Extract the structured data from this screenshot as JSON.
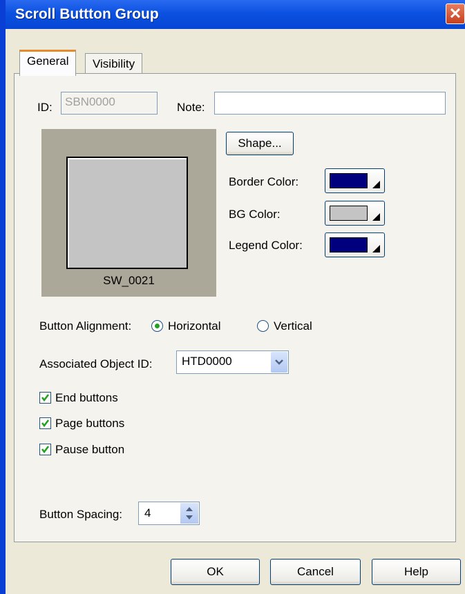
{
  "window": {
    "title": "Scroll Buttton Group",
    "close_label": "✕"
  },
  "tabs": [
    {
      "label": "General"
    },
    {
      "label": "Visibility"
    }
  ],
  "general": {
    "id_label": "ID:",
    "id_value": "SBN0000",
    "note_label": "Note:",
    "note_value": "",
    "shape_button": "Shape...",
    "preview_caption": "SW_0021",
    "border_color_label": "Border Color:",
    "border_color": "#00007f",
    "bg_color_label": "BG Color:",
    "bg_color": "#c4c4c4",
    "legend_color_label": "Legend Color:",
    "legend_color": "#00007f",
    "alignment_label": "Button Alignment:",
    "alignment_options": [
      "Horizontal",
      "Vertical"
    ],
    "alignment_selected": "Horizontal",
    "assoc_label": "Associated Object ID:",
    "assoc_value": "HTD0000",
    "checkboxes": [
      {
        "label": "End buttons",
        "checked": true
      },
      {
        "label": "Page buttons",
        "checked": true
      },
      {
        "label": "Pause button",
        "checked": true
      }
    ],
    "spacing_label": "Button Spacing:",
    "spacing_value": "4"
  },
  "footer": {
    "ok": "OK",
    "cancel": "Cancel",
    "help": "Help"
  }
}
